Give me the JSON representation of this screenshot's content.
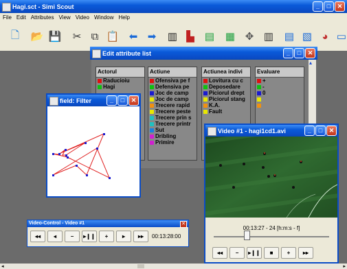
{
  "main": {
    "title": "Hagi.sct - Simi Scout",
    "menu": [
      "File",
      "Edit",
      "Attributes",
      "View",
      "Video",
      "Window",
      "Help"
    ],
    "toolbar_icons": [
      "new-file-icon",
      "open-folder-icon",
      "save-icon",
      "cut-icon",
      "copy-icon",
      "paste-icon",
      "arrow-left-icon",
      "arrow-right-icon",
      "attribute-list-icon",
      "attribute-edit-icon",
      "field-icon",
      "field-filter-icon",
      "player-icon",
      "statistics-icon",
      "report-icon",
      "export-icon",
      "chart-icon",
      "video-icon"
    ]
  },
  "attr": {
    "title": "Edit attribute list",
    "columns": [
      {
        "header": "Actorul",
        "items": [
          {
            "label": "Raducioiu",
            "color": "#e01010"
          },
          {
            "label": "Hagi",
            "color": "#10c010"
          }
        ]
      },
      {
        "header": "Actiune",
        "items": [
          {
            "label": "Ofensiva pe f",
            "color": "#e01010"
          },
          {
            "label": "Defensiva pe",
            "color": "#10c010"
          },
          {
            "label": "Joc de camp",
            "color": "#1a1ad0"
          },
          {
            "label": "Joc de camp",
            "color": "#e8e800"
          },
          {
            "label": "Trecere rapid",
            "color": "#f09010"
          },
          {
            "label": "Trecere peste",
            "color": "#e8e800"
          },
          {
            "label": "Trecere prin s",
            "color": "#20c0c0"
          },
          {
            "label": "Trecere printr",
            "color": "#20c0c0"
          },
          {
            "label": "Sut",
            "color": "#1a80e0"
          },
          {
            "label": "Dribling",
            "color": "#d020d0"
          },
          {
            "label": "Primire",
            "color": "#d020d0"
          }
        ]
      },
      {
        "header": "Actiunea indivi",
        "items": [
          {
            "label": "Lovitura cu c",
            "color": "#e01010"
          },
          {
            "label": "Deposedare",
            "color": "#10c010"
          },
          {
            "label": "Piciorul drept",
            "color": "#1a1ad0"
          },
          {
            "label": "Piciorul stang",
            "color": "#e8e800"
          },
          {
            "label": "K.A.",
            "color": "#f09010"
          },
          {
            "label": "Fault",
            "color": "#e8e800"
          }
        ]
      },
      {
        "header": "Evaluare",
        "items": [
          {
            "label": "+",
            "color": "#e01010"
          },
          {
            "label": "-",
            "color": "#10c010"
          },
          {
            "label": "0",
            "color": "#1a1ad0"
          },
          {
            "label": "",
            "color": "#e8e800"
          },
          {
            "label": "",
            "color": "#f09010"
          }
        ]
      }
    ]
  },
  "field": {
    "title": "field: Filter"
  },
  "video": {
    "title": "Video #1 - hagi1cd1.avi",
    "timecode": "00:13:27 - 24  [h:m:s - f]",
    "position_fraction": 0.28,
    "controls": [
      "◂◂",
      "−",
      "▸❙❙",
      "■",
      "+",
      "▸▸"
    ]
  },
  "vc": {
    "title": "Video-Control - Video #1",
    "controls": [
      "◂◂",
      "◂",
      "−",
      "▸❙❙",
      "+",
      "▸",
      "▸▸"
    ],
    "time": "00:13:28:00"
  }
}
